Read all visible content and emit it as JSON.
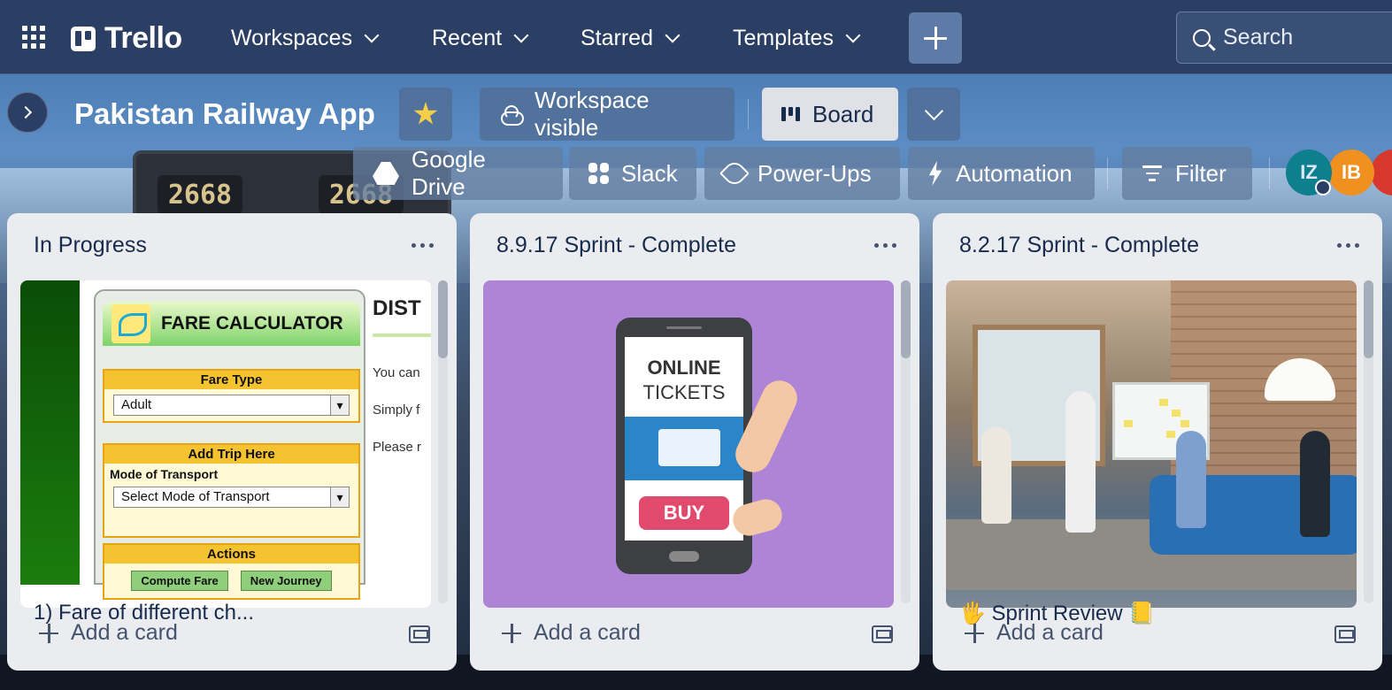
{
  "nav": {
    "logo_text": "Trello",
    "menus": [
      "Workspaces",
      "Recent",
      "Starred",
      "Templates"
    ],
    "search_placeholder": "Search"
  },
  "board": {
    "title": "Pakistan Railway App",
    "visibility_label": "Workspace visible",
    "view_label": "Board",
    "background_numbers": [
      "2668",
      "2668"
    ],
    "toolbar": {
      "google_drive": "Google Drive",
      "slack": "Slack",
      "power_ups": "Power-Ups",
      "automation": "Automation",
      "filter": "Filter"
    },
    "members": [
      "IZ",
      "IB"
    ]
  },
  "lists": [
    {
      "title": "In Progress",
      "add_card": "Add a card",
      "cover": {
        "title": "FARE CALCULATOR",
        "fare_type_label": "Fare Type",
        "fare_type_value": "Adult",
        "add_trip_label": "Add Trip Here",
        "mode_label": "Mode of Transport",
        "mode_value": "Select Mode of Transport",
        "actions_label": "Actions",
        "compute_btn": "Compute Fare",
        "new_journey_btn": "New Journey",
        "side_heading": "DIST",
        "side_lines": [
          "You can",
          "Simply f",
          "Please r"
        ]
      },
      "card_peek": "1) Fare of different ch..."
    },
    {
      "title": "8.9.17 Sprint - Complete",
      "add_card": "Add a card",
      "cover": {
        "line1": "ONLINE",
        "line2": "TICKETS",
        "buy": "BUY"
      }
    },
    {
      "title": "8.2.17 Sprint - Complete",
      "add_card": "Add a card",
      "card_peek": "🖐 Sprint Review 📒"
    }
  ]
}
